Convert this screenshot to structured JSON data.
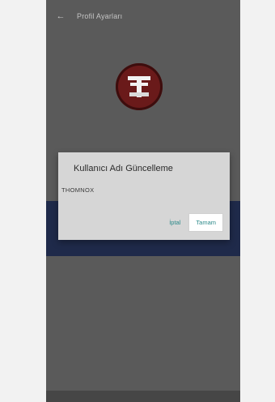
{
  "app_bar": {
    "back_icon": "back-arrow-icon",
    "title": "Profil Ayarları"
  },
  "logo": {
    "icon": "tt-logo-icon",
    "color": "#6a1a1a"
  },
  "dialog": {
    "title": "Kullanıcı Adı Güncelleme",
    "input_value": "THOMNOX",
    "cancel_label": "İptal",
    "ok_label": "Tamam"
  },
  "colors": {
    "dialog_bg": "#d6d6d6",
    "accent": "#2d8a8a",
    "overlay": "#5a5a5a",
    "band": "#1f2a4a"
  }
}
